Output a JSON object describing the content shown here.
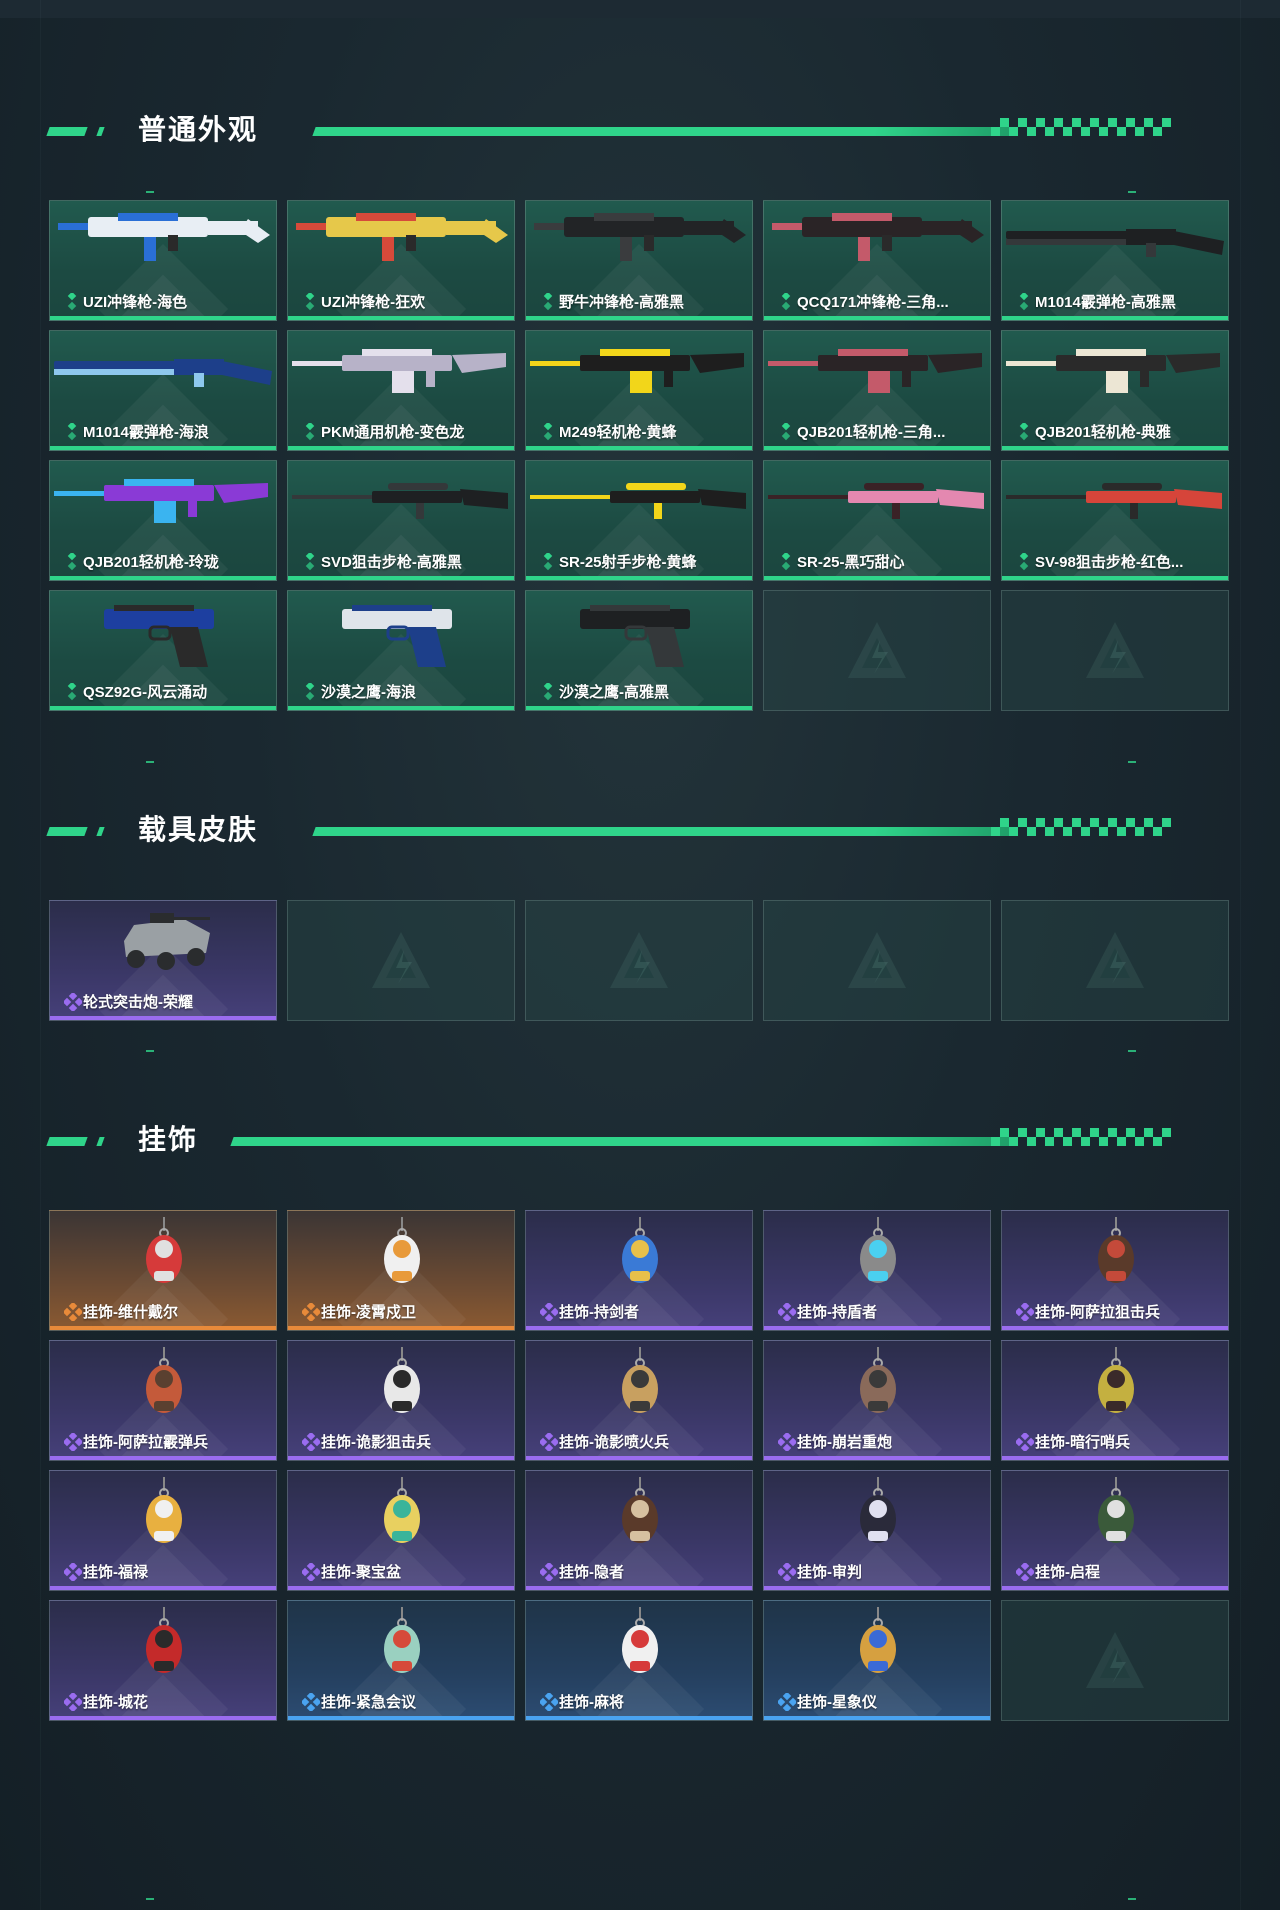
{
  "sections": {
    "weapons": {
      "title": "普通外观",
      "items": [
        {
          "name": "UZI冲锋枪-海色",
          "rarity": "green",
          "icon": "smg-icon",
          "c1": "#e8eef4",
          "c2": "#2a6fd6"
        },
        {
          "name": "UZI冲锋枪-狂欢",
          "rarity": "green",
          "icon": "smg-icon",
          "c1": "#e6c84a",
          "c2": "#d64a3a"
        },
        {
          "name": "野牛冲锋枪-高雅黑",
          "rarity": "green",
          "icon": "smg-icon",
          "c1": "#222426",
          "c2": "#3a3c3e"
        },
        {
          "name": "QCQ171冲锋枪-三角...",
          "rarity": "green",
          "icon": "smg-icon",
          "c1": "#2a2426",
          "c2": "#c45a6a"
        },
        {
          "name": "M1014霰弹枪-高雅黑",
          "rarity": "green",
          "icon": "shotgun-icon",
          "c1": "#1e2022",
          "c2": "#34383a"
        },
        {
          "name": "M1014霰弹枪-海浪",
          "rarity": "green",
          "icon": "shotgun-icon",
          "c1": "#1d3f8a",
          "c2": "#8ec8ee"
        },
        {
          "name": "PKM通用机枪-变色龙",
          "rarity": "green",
          "icon": "machine-gun-icon",
          "c1": "#b7b2c8",
          "c2": "#e4e0ec"
        },
        {
          "name": "M249轻机枪-黄蜂",
          "rarity": "green",
          "icon": "machine-gun-icon",
          "c1": "#1e1e1e",
          "c2": "#f2d61a"
        },
        {
          "name": "QJB201轻机枪-三角...",
          "rarity": "green",
          "icon": "machine-gun-icon",
          "c1": "#2a2426",
          "c2": "#c45a6a"
        },
        {
          "name": "QJB201轻机枪-典雅",
          "rarity": "green",
          "icon": "machine-gun-icon",
          "c1": "#2a2a2a",
          "c2": "#ece6d4"
        },
        {
          "name": "QJB201轻机枪-玲珑",
          "rarity": "green",
          "icon": "machine-gun-icon",
          "c1": "#8a3ad6",
          "c2": "#3ab4f0"
        },
        {
          "name": "SVD狙击步枪-高雅黑",
          "rarity": "green",
          "icon": "sniper-icon",
          "c1": "#1e2022",
          "c2": "#34383a"
        },
        {
          "name": "SR-25射手步枪-黄蜂",
          "rarity": "green",
          "icon": "sniper-icon",
          "c1": "#1e1e1e",
          "c2": "#f2d61a"
        },
        {
          "name": "SR-25-黑巧甜心",
          "rarity": "green",
          "icon": "sniper-icon",
          "c1": "#e488b0",
          "c2": "#3a2226"
        },
        {
          "name": "SV-98狙击步枪-红色...",
          "rarity": "green",
          "icon": "sniper-icon",
          "c1": "#d6453a",
          "c2": "#2a2a2a"
        },
        {
          "name": "QSZ92G-风云涌动",
          "rarity": "green",
          "icon": "pistol-icon",
          "c1": "#1d3fa0",
          "c2": "#2a2a2a"
        },
        {
          "name": "沙漠之鹰-海浪",
          "rarity": "green",
          "icon": "pistol-icon",
          "c1": "#dfe4ea",
          "c2": "#1d3f8a"
        },
        {
          "name": "沙漠之鹰-高雅黑",
          "rarity": "green",
          "icon": "pistol-icon",
          "c1": "#1e2022",
          "c2": "#34383a"
        },
        {
          "name": "",
          "rarity": "empty"
        },
        {
          "name": "",
          "rarity": "empty"
        }
      ]
    },
    "vehicles": {
      "title": "载具皮肤",
      "items": [
        {
          "name": "轮式突击炮-荣耀",
          "rarity": "purple",
          "icon": "vehicle-icon",
          "c1": "#9aa0a4",
          "c2": "#2a2c2e"
        },
        {
          "name": "",
          "rarity": "empty"
        },
        {
          "name": "",
          "rarity": "empty"
        },
        {
          "name": "",
          "rarity": "empty"
        },
        {
          "name": "",
          "rarity": "empty"
        }
      ]
    },
    "charms": {
      "title": "挂饰",
      "items": [
        {
          "name": "挂饰-维什戴尔",
          "rarity": "orange",
          "icon": "charm-icon",
          "c1": "#d63a3a",
          "c2": "#e0e0e0"
        },
        {
          "name": "挂饰-凌霄戍卫",
          "rarity": "orange",
          "icon": "charm-icon",
          "c1": "#f0f0f0",
          "c2": "#e89a3a"
        },
        {
          "name": "挂饰-持剑者",
          "rarity": "purple",
          "icon": "charm-icon",
          "c1": "#3a7ad6",
          "c2": "#e8c04a"
        },
        {
          "name": "挂饰-持盾者",
          "rarity": "purple",
          "icon": "charm-icon",
          "c1": "#8a8a8a",
          "c2": "#4ad0f0"
        },
        {
          "name": "挂饰-阿萨拉狙击兵",
          "rarity": "purple",
          "icon": "charm-icon",
          "c1": "#5a3a2a",
          "c2": "#c44a3a"
        },
        {
          "name": "挂饰-阿萨拉霰弹兵",
          "rarity": "purple",
          "icon": "charm-icon",
          "c1": "#c45a3a",
          "c2": "#5a4030"
        },
        {
          "name": "挂饰-诡影狙击兵",
          "rarity": "purple",
          "icon": "charm-icon",
          "c1": "#e8e8e8",
          "c2": "#2a2a2a"
        },
        {
          "name": "挂饰-诡影喷火兵",
          "rarity": "purple",
          "icon": "charm-icon",
          "c1": "#c8a060",
          "c2": "#3a3a3a"
        },
        {
          "name": "挂饰-崩岩重炮",
          "rarity": "purple",
          "icon": "charm-icon",
          "c1": "#8a6a5a",
          "c2": "#3a3a3a"
        },
        {
          "name": "挂饰-暗行哨兵",
          "rarity": "purple",
          "icon": "charm-icon",
          "c1": "#c4b040",
          "c2": "#3a2a2a"
        },
        {
          "name": "挂饰-福禄",
          "rarity": "purple",
          "icon": "charm-icon",
          "c1": "#e8b040",
          "c2": "#f0f0f0"
        },
        {
          "name": "挂饰-聚宝盆",
          "rarity": "purple",
          "icon": "charm-icon",
          "c1": "#e8d060",
          "c2": "#3ab49a"
        },
        {
          "name": "挂饰-隐者",
          "rarity": "purple",
          "icon": "charm-icon",
          "c1": "#5a3a2a",
          "c2": "#d6c0a0"
        },
        {
          "name": "挂饰-审判",
          "rarity": "purple",
          "icon": "charm-icon",
          "c1": "#2a2a3a",
          "c2": "#e0e0f0"
        },
        {
          "name": "挂饰-启程",
          "rarity": "purple",
          "icon": "charm-icon",
          "c1": "#3a5a3a",
          "c2": "#e0e0e0"
        },
        {
          "name": "挂饰-城花",
          "rarity": "purple",
          "icon": "charm-icon",
          "c1": "#c42a2a",
          "c2": "#2a2a2a"
        },
        {
          "name": "挂饰-紧急会议",
          "rarity": "blue",
          "icon": "charm-icon",
          "c1": "#9ad0c0",
          "c2": "#d64a3a"
        },
        {
          "name": "挂饰-麻将",
          "rarity": "blue",
          "icon": "charm-icon",
          "c1": "#f0f0f0",
          "c2": "#d63a3a"
        },
        {
          "name": "挂饰-星象仪",
          "rarity": "blue",
          "icon": "charm-icon",
          "c1": "#d6a040",
          "c2": "#3a6ad6"
        },
        {
          "name": "",
          "rarity": "empty"
        }
      ]
    }
  },
  "colors": {
    "accent_green": "#2fd48a",
    "rarity_purple": "#9a6cf0",
    "rarity_orange": "#e88a3a",
    "rarity_blue": "#4aa3f0"
  }
}
